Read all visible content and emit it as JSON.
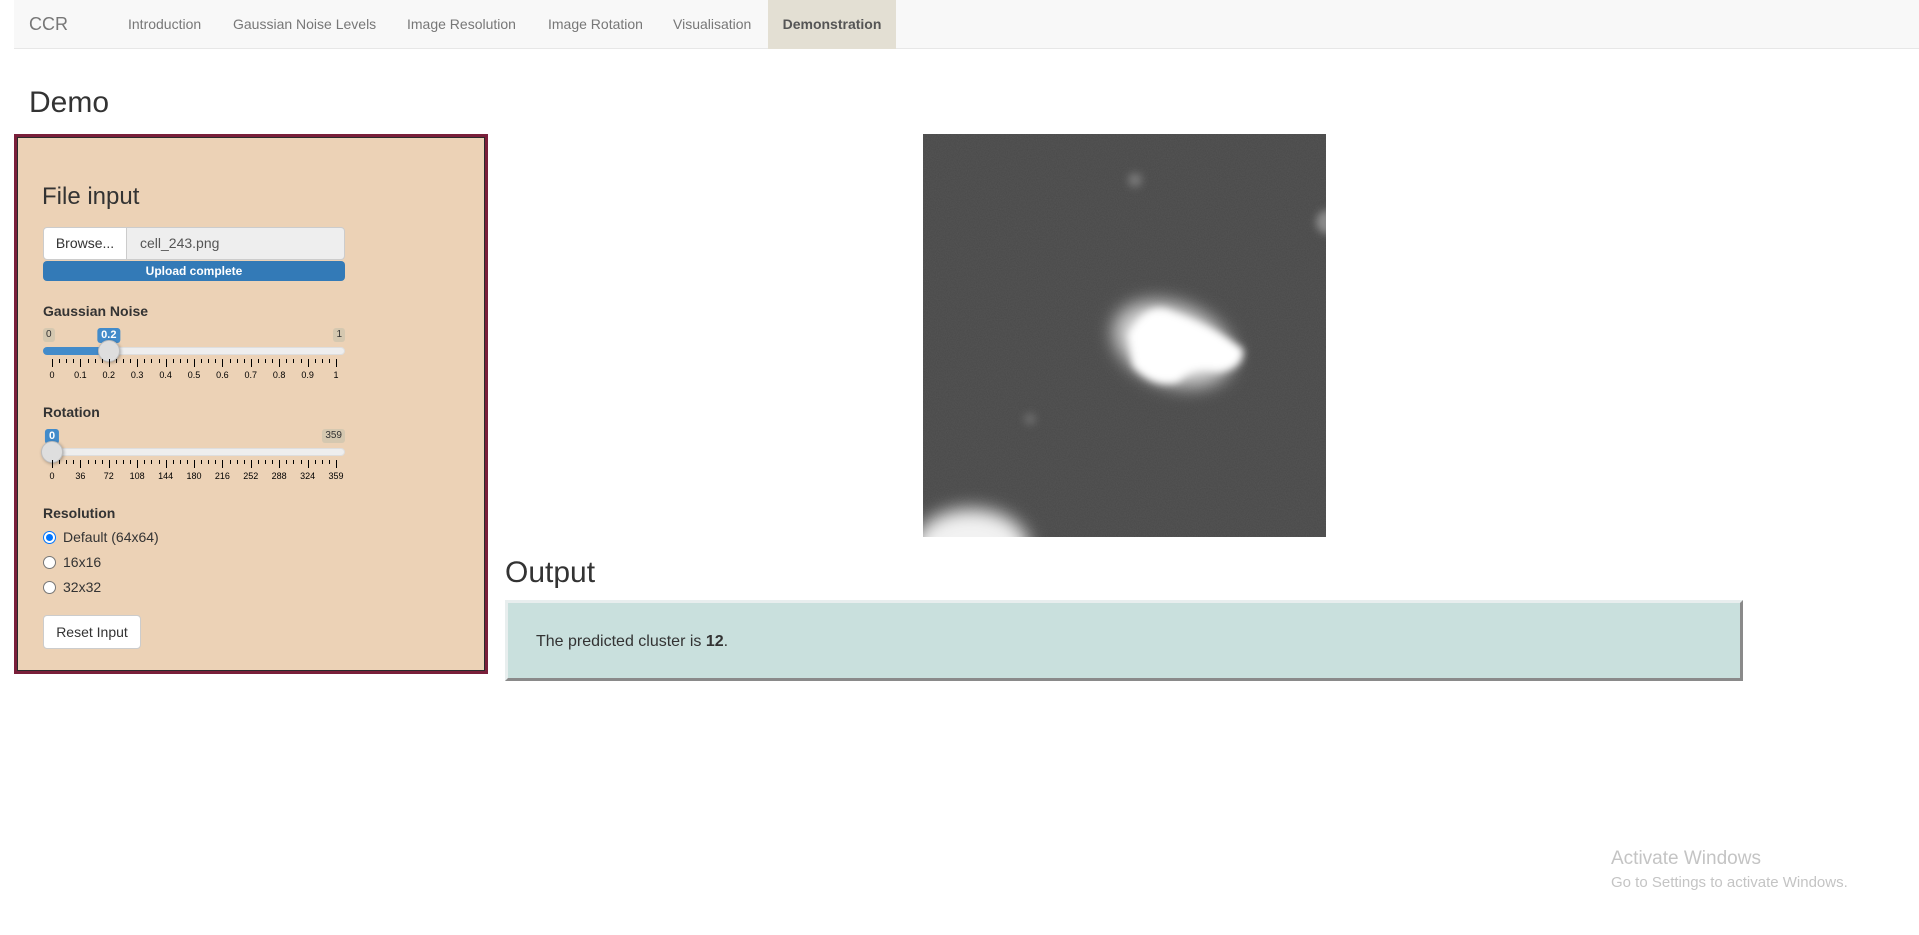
{
  "navbar": {
    "brand": "CCR",
    "tabs": [
      {
        "label": "Introduction",
        "active": false
      },
      {
        "label": "Gaussian Noise Levels",
        "active": false
      },
      {
        "label": "Image Resolution",
        "active": false
      },
      {
        "label": "Image Rotation",
        "active": false
      },
      {
        "label": "Visualisation",
        "active": false
      },
      {
        "label": "Demonstration",
        "active": true
      }
    ]
  },
  "page": {
    "title": "Demo"
  },
  "sidebar": {
    "file_input": {
      "title": "File input",
      "browse_label": "Browse...",
      "file_name": "cell_243.png",
      "progress_text": "Upload complete",
      "progress_fraction": 1.0
    },
    "gaussian_noise": {
      "label": "Gaussian Noise",
      "min": 0,
      "max": 1,
      "value": 0.2,
      "min_label": "0",
      "max_label": "1",
      "value_label": "0.2",
      "ticks": [
        "0",
        "0.1",
        "0.2",
        "0.3",
        "0.4",
        "0.5",
        "0.6",
        "0.7",
        "0.8",
        "0.9",
        "1"
      ]
    },
    "rotation": {
      "label": "Rotation",
      "min": 0,
      "max": 359,
      "value": 0,
      "min_label": "0",
      "max_label": "359",
      "value_label": "0",
      "ticks": [
        "0",
        "36",
        "72",
        "108",
        "144",
        "180",
        "216",
        "252",
        "288",
        "324",
        "359"
      ]
    },
    "resolution": {
      "label": "Resolution",
      "options": [
        {
          "label": "Default (64x64)",
          "checked": true
        },
        {
          "label": "16x16",
          "checked": false
        },
        {
          "label": "32x32",
          "checked": false
        }
      ]
    },
    "reset_label": "Reset Input"
  },
  "output": {
    "title": "Output",
    "prefix": "The predicted cluster is ",
    "cluster": "12",
    "suffix": "."
  },
  "watermark": {
    "line1": "Activate Windows",
    "line2": "Go to Settings to activate Windows."
  },
  "colors": {
    "well_bg": "#ecd2b6",
    "well_border": "#7a1f3a",
    "accent": "#428bca",
    "output_bg": "#c9e0dd",
    "active_tab_bg": "#e3dfd3"
  }
}
